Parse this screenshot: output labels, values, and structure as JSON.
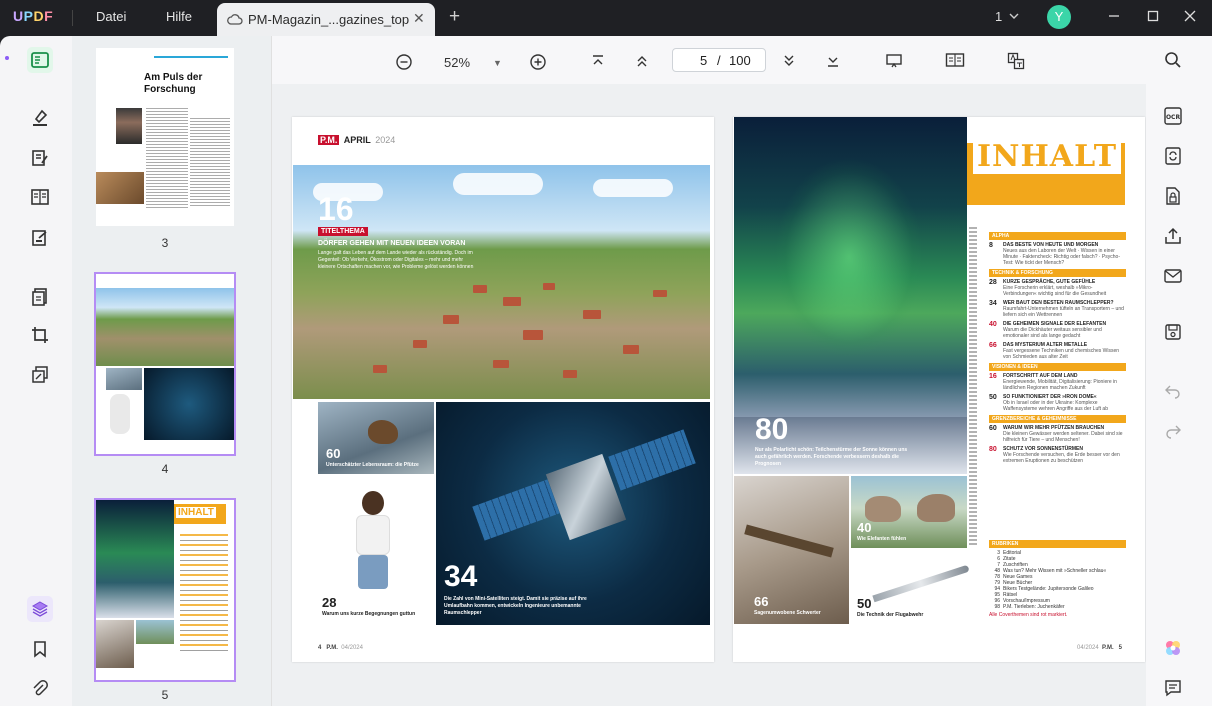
{
  "app": {
    "logo_text": "UPDF",
    "menu": {
      "file": "Datei",
      "help": "Hilfe"
    },
    "tab_title": "PM-Magazin_...gazines_top",
    "page_count_indicator": "1",
    "avatar_initial": "Y"
  },
  "toolbar": {
    "zoom": "52%",
    "current_page": "5",
    "page_separator": "/",
    "total_pages": "100"
  },
  "thumbnails": {
    "items": [
      {
        "label": "3",
        "title": "Am Puls der Forschung"
      },
      {
        "label": "4"
      },
      {
        "label": "5",
        "title": "INHALT"
      }
    ]
  },
  "page4": {
    "brand": "P.M.",
    "month": "APRIL",
    "year": "2024",
    "hero_number": "16",
    "hero_tag": "TITELTHEMA",
    "hero_headline": "DÖRFER GEHEN MIT NEUEN IDEEN VORAN",
    "hero_deck": "Lange galt das Leben auf dem Lande wieder als rückständig. Doch im Gegenteil: Ob Verkehr, Ökostrom oder Digitales – mehr und mehr kleinere Ortschaften machen vor, wie Probleme gelöst werden können",
    "bird_number": "60",
    "bird_caption": "Unterschätzter Lebensraum: die Pfütze",
    "man_number": "28",
    "man_caption": "Warum uns kurze Begegnungen guttun",
    "sat_number": "34",
    "sat_caption": "Die Zahl von Mini-Satelliten steigt. Damit sie präzise auf ihre Umlaufbahn kommen, entwickeln Ingenieure unbemannte Raumschlepper",
    "footer_page": "4",
    "footer_brand": "P.M.",
    "footer_issue": "04/2024"
  },
  "page5": {
    "title": "INHALT",
    "aurora_number": "80",
    "aurora_caption": "Nur als Polarlicht schön: Teilchenstürme der Sonne können uns auch gefährlich werden. Forschende verbessern deshalb die Prognosen",
    "lab_number": "66",
    "lab_caption": "Sagenumwobene Schwerter",
    "elefant_number": "40",
    "elefant_caption": "Wie Elefanten fühlen",
    "missile_number": "50",
    "missile_caption": "Die Technik der Flugabwehr",
    "sections": [
      {
        "name": "ALPHA",
        "items": [
          {
            "n": "8",
            "h": "DAS BESTE VON HEUTE UND MORGEN",
            "d": "Neues aus den Laboren der Welt · Wissen in einer Minute · Faktencheck: Richtig oder falsch? · Psycho-Test: Wie tickt der Mensch?"
          }
        ]
      },
      {
        "name": "TECHNIK & FORSCHUNG",
        "items": [
          {
            "n": "28",
            "h": "KURZE GESPRÄCHE, GUTE GEFÜHLE",
            "d": "Eine Forscherin erklärt, weshalb »Mikro-Verbindungen« wichtig sind für die Gesundheit"
          },
          {
            "n": "34",
            "h": "WER BAUT DEN BESTEN RAUMSCHLEPPER?",
            "d": "Raumfahrt-Unternehmen tüfteln an Transportern – und liefern sich ein Wettrennen"
          },
          {
            "n": "40",
            "h": "DIE GEHEIMEN SIGNALE DER ELEFANTEN",
            "d": "Warum die Dickhäuter weitaus sensibler und emotionaler sind als lange gedacht"
          },
          {
            "n": "66",
            "h": "DAS MYSTERIUM ALTER METALLE",
            "d": "Fast vergessene Techniken und chemisches Wissen von Schmieden aus alter Zeit"
          }
        ]
      },
      {
        "name": "VISIONEN & IDEEN",
        "items": [
          {
            "n": "16",
            "h": "FORTSCHRITT AUF DEM LAND",
            "d": "Energiewende, Mobilität, Digitalisierung: Pioniere in ländlichen Regionen machen Zukunft"
          },
          {
            "n": "50",
            "h": "SO FUNKTIONIERT DER »IRON DOME«",
            "d": "Ob in Israel oder in der Ukraine: Komplexe Waffensysteme wehren Angriffe aus der Luft ab"
          }
        ]
      },
      {
        "name": "GRENZBEREICHE & GEHEIMNISSE",
        "items": [
          {
            "n": "60",
            "h": "WARUM WIR MEHR PFÜTZEN BRAUCHEN",
            "d": "Die kleinen Gewässer werden seltener. Dabei sind sie hilfreich für Tiere – und Menschen!"
          },
          {
            "n": "80",
            "h": "SCHUTZ VOR SONNENSTÜRMEN",
            "d": "Wie Forschende versuchen, die Erde besser vor den extremen Eruptionen zu beschützen"
          }
        ]
      }
    ],
    "rubriken_title": "RUBRIKEN",
    "rubriken": [
      {
        "n": "3",
        "t": "Editorial"
      },
      {
        "n": "6",
        "t": "Zitate"
      },
      {
        "n": "7",
        "t": "Zuschriften"
      },
      {
        "n": "48",
        "t": "Was tun? Mehr Wissen mit »Schneller schlau«"
      },
      {
        "n": "78",
        "t": "Neue Games"
      },
      {
        "n": "79",
        "t": "Neue Bücher"
      },
      {
        "n": "94",
        "t": "Bikers Testgelände: Jupitersonde Galileo"
      },
      {
        "n": "95",
        "t": "Rätsel"
      },
      {
        "n": "96",
        "t": "Vorschau/Impressum"
      },
      {
        "n": "98",
        "t": "P.M. Tierleben: Juchenkäfer"
      }
    ],
    "cover_note": "Alle Coverthemen sind rot markiert.",
    "footer_issue": "04/2024",
    "footer_brand": "P.M.",
    "footer_page": "5"
  },
  "colors": {
    "accent": "#f2a71b",
    "brand_red": "#c8102e",
    "selection": "#b58cf4"
  }
}
